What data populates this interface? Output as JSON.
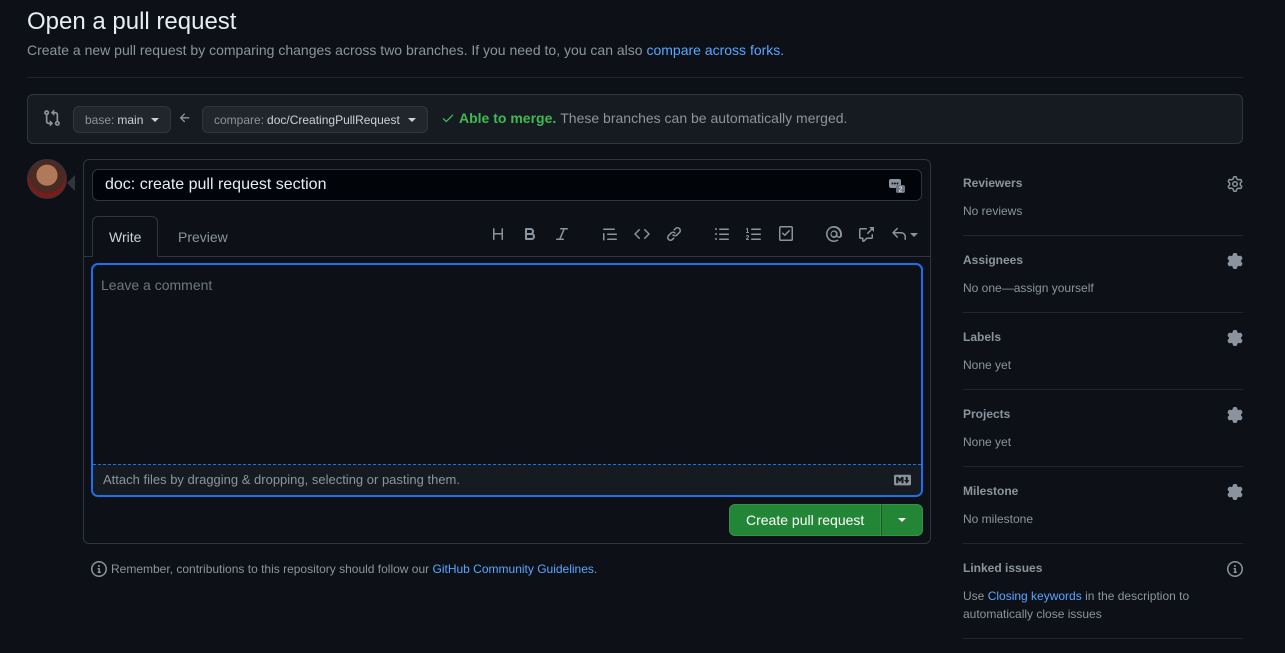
{
  "header": {
    "title": "Open a pull request",
    "subtitle_prefix": "Create a new pull request by comparing changes across two branches. If you need to, you can also ",
    "subtitle_link": "compare across forks.",
    "subtitle_suffix": ""
  },
  "compare_bar": {
    "base_key": "base:",
    "base_value": "main",
    "compare_key": "compare:",
    "compare_value": "doc/CreatingPullRequest",
    "merge_ok": "Able to merge.",
    "merge_desc": "These branches can be automatically merged."
  },
  "form": {
    "title_value": "doc: create pull request section",
    "tabs": [
      {
        "label": "Write",
        "active": true
      },
      {
        "label": "Preview",
        "active": false
      }
    ],
    "comment_placeholder": "Leave a comment",
    "attach_text": "Attach files by dragging & dropping, selecting or pasting them.",
    "submit_label": "Create pull request"
  },
  "note": {
    "prefix": "Remember, contributions to this repository should follow our ",
    "link": "GitHub Community Guidelines",
    "suffix": "."
  },
  "sidebar": {
    "reviewers": {
      "title": "Reviewers",
      "value": "No reviews"
    },
    "assignees": {
      "title": "Assignees",
      "value": "No one—assign yourself"
    },
    "labels": {
      "title": "Labels",
      "value": "None yet"
    },
    "projects": {
      "title": "Projects",
      "value": "None yet"
    },
    "milestone": {
      "title": "Milestone",
      "value": "No milestone"
    },
    "linked_issues": {
      "title": "Linked issues",
      "value_prefix": "Use ",
      "value_link": "Closing keywords",
      "value_suffix": " in the description to automatically close issues"
    }
  },
  "colors": {
    "background": "#0d1117",
    "border": "#30363d",
    "accent_blue": "#58a6ff",
    "focus_blue": "#1f6feb",
    "success_green": "#3fb950",
    "button_green": "#238636"
  },
  "icons": [
    "git-compare-icon",
    "caret-down-icon",
    "arrow-left-icon",
    "check-icon",
    "saved-replies-icon",
    "heading-icon",
    "bold-icon",
    "italic-icon",
    "quote-icon",
    "code-icon",
    "link-icon",
    "unordered-list-icon",
    "ordered-list-icon",
    "task-list-icon",
    "mention-icon",
    "cross-reference-icon",
    "reply-icon",
    "markdown-icon",
    "info-icon",
    "gear-icon"
  ]
}
